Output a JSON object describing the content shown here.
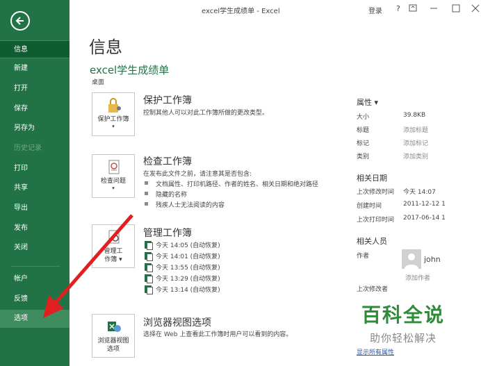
{
  "window": {
    "title": "excel学生成绩单  -  Excel",
    "signin": "登录",
    "help": "?"
  },
  "sidebar": {
    "items": [
      {
        "label": "信息"
      },
      {
        "label": "新建"
      },
      {
        "label": "打开"
      },
      {
        "label": "保存"
      },
      {
        "label": "另存为"
      },
      {
        "label": "历史记录"
      },
      {
        "label": "打印"
      },
      {
        "label": "共享"
      },
      {
        "label": "导出"
      },
      {
        "label": "发布"
      },
      {
        "label": "关闭"
      },
      {
        "label": "帐户"
      },
      {
        "label": "反馈"
      },
      {
        "label": "选项"
      }
    ]
  },
  "main": {
    "title": "信息",
    "doc_name": "excel学生成绩单",
    "doc_location": "桌面",
    "protect": {
      "tile_label_1": "保护工作簿",
      "tile_label_2": "▾",
      "title": "保护工作簿",
      "desc": "控制其他人可以对此工作簿所做的更改类型。"
    },
    "inspect": {
      "tile_label_1": "检查问题",
      "tile_label_2": "▾",
      "title": "检查工作簿",
      "desc": "在发布此文件之前，请注意其是否包含:",
      "bullets": [
        "文档属性、打印机路径、作者的姓名、相关日期和绝对路径",
        "隐藏的名称",
        "残疾人士无法阅读的内容"
      ]
    },
    "manage": {
      "tile_label_1": "管理工",
      "tile_label_2": "作簿 ▾",
      "title": "管理工作簿",
      "versions": [
        "今天 14:05 (自动恢复)",
        "今天 14:01 (自动恢复)",
        "今天 13:55 (自动恢复)",
        "今天 13:29 (自动恢复)",
        "今天 13:14 (自动恢复)"
      ]
    },
    "browser": {
      "tile_label_1": "浏览器视图",
      "tile_label_2": "选项",
      "title": "浏览器视图选项",
      "desc": "选择在 Web 上查看此工作簿时用户可以看到的内容。"
    }
  },
  "properties": {
    "heading": "属性 ▾",
    "rows": [
      {
        "key": "大小",
        "value": "39.8KB"
      },
      {
        "key": "标题",
        "value": "添加标题"
      },
      {
        "key": "标记",
        "value": "添加标记"
      },
      {
        "key": "类别",
        "value": "添加类别"
      }
    ],
    "dates_heading": "相关日期",
    "dates": [
      {
        "key": "上次修改时间",
        "value": "今天 14:07"
      },
      {
        "key": "创建时间",
        "value": "2011-12-12 1"
      },
      {
        "key": "上次打印时间",
        "value": "2017-06-14 1"
      }
    ],
    "people_heading": "相关人员",
    "author_key": "作者",
    "author_name": "john",
    "add_author": "添加作者",
    "last_modified_by_key": "上次修改者",
    "show_all": "显示所有属性"
  },
  "watermark": {
    "main": "百科全说",
    "sub": "助你轻松解决"
  },
  "colors": {
    "sidebar": "#217346",
    "sidebar_active": "#0f5c31",
    "arrow": "#e02020"
  }
}
